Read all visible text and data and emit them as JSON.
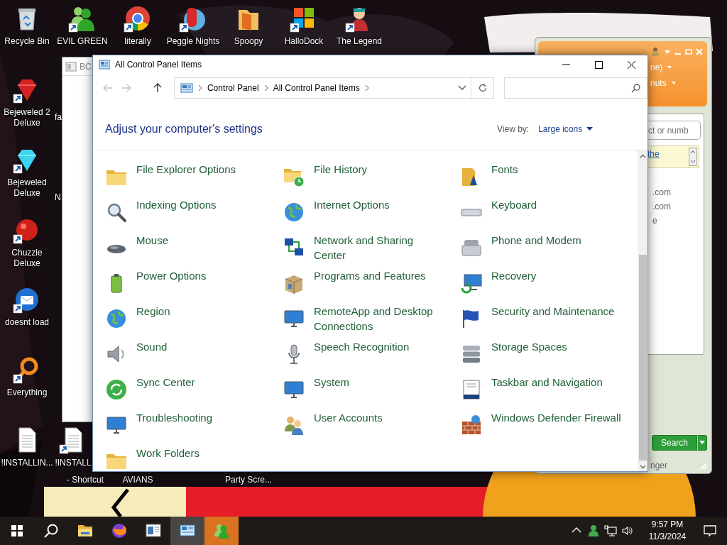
{
  "desktop_icons": [
    {
      "label": "Recycle Bin",
      "kind": "bin",
      "shortcut": false
    },
    {
      "label": "EVIL GREEN",
      "kind": "people",
      "shortcut": true
    },
    {
      "label": "literally",
      "kind": "ring-logo",
      "shortcut": true
    },
    {
      "label": "Peggle Nights",
      "kind": "game",
      "shortcut": true
    },
    {
      "label": "Spoopy",
      "kind": "folder",
      "shortcut": false
    },
    {
      "label": "HalloDock",
      "kind": "tiles",
      "shortcut": true
    },
    {
      "label": "The Legend",
      "kind": "figure",
      "shortcut": true
    },
    {
      "label": "Bejeweled 2 Deluxe",
      "kind": "gem-red",
      "shortcut": true
    },
    {
      "label": "Bejeweled Deluxe",
      "kind": "gem-blue",
      "shortcut": true
    },
    {
      "label": "Chuzzle Deluxe",
      "kind": "ball",
      "shortcut": true
    },
    {
      "label": "doesnt load",
      "kind": "envelope",
      "shortcut": true
    },
    {
      "label": "Everything",
      "kind": "magnifier",
      "shortcut": true
    },
    {
      "label": "!INSTALLIN...",
      "kind": "document",
      "shortcut": false
    },
    {
      "label": "!INSTALL",
      "kind": "document",
      "shortcut": true
    },
    {
      "label": "- Shortcut",
      "kind": "covered"
    },
    {
      "label": "AVIANS",
      "kind": "covered"
    },
    {
      "label": "Party Scre...",
      "kind": "covered"
    },
    {
      "label": "fa",
      "kind": "covered"
    },
    {
      "label": "N",
      "kind": "covered"
    }
  ],
  "left_window": {
    "title": "BC"
  },
  "messenger_window": {
    "header_lines": [
      "ne)",
      "nuts"
    ],
    "search": {
      "placeholder": "ct or numb"
    },
    "notice_link": "the",
    "list": [
      ".com",
      ".com",
      "e"
    ],
    "search_button": "Search",
    "status": "nger"
  },
  "control_panel": {
    "title": "All Control Panel Items",
    "nav": {
      "back_disabled": true,
      "forward_disabled": true
    },
    "breadcrumbs": [
      "Control Panel",
      "All Control Panel Items"
    ],
    "heading": "Adjust your computer's settings",
    "view_by_label": "View by:",
    "view_by_value": "Large icons",
    "items": [
      {
        "label": "File Explorer Options",
        "kind": "folder"
      },
      {
        "label": "File History",
        "kind": "history"
      },
      {
        "label": "Fonts",
        "kind": "fonts"
      },
      {
        "label": "Indexing Options",
        "kind": "magnifier"
      },
      {
        "label": "Internet Options",
        "kind": "globe"
      },
      {
        "label": "Keyboard",
        "kind": "keyboard"
      },
      {
        "label": "Mouse",
        "kind": "mouse"
      },
      {
        "label": "Network and Sharing Center",
        "kind": "network"
      },
      {
        "label": "Phone and Modem",
        "kind": "phone"
      },
      {
        "label": "Power Options",
        "kind": "battery"
      },
      {
        "label": "Programs and Features",
        "kind": "box"
      },
      {
        "label": "Recovery",
        "kind": "recovery"
      },
      {
        "label": "Region",
        "kind": "globe"
      },
      {
        "label": "RemoteApp and Desktop Connections",
        "kind": "monitor"
      },
      {
        "label": "Security and Maintenance",
        "kind": "flag"
      },
      {
        "label": "Sound",
        "kind": "speaker"
      },
      {
        "label": "Speech Recognition",
        "kind": "mic"
      },
      {
        "label": "Storage Spaces",
        "kind": "disks"
      },
      {
        "label": "Sync Center",
        "kind": "sync"
      },
      {
        "label": "System",
        "kind": "monitor"
      },
      {
        "label": "Taskbar and Navigation",
        "kind": "taskbar"
      },
      {
        "label": "Troubleshooting",
        "kind": "monitor"
      },
      {
        "label": "User Accounts",
        "kind": "users"
      },
      {
        "label": "Windows Defender Firewall",
        "kind": "wall"
      },
      {
        "label": "Work Folders",
        "kind": "folder"
      }
    ]
  },
  "taskbar": {
    "apps": [
      {
        "kind": "folder",
        "active": false,
        "attention": false
      },
      {
        "kind": "fox",
        "active": false,
        "attention": false
      },
      {
        "kind": "window",
        "active": false,
        "attention": false
      },
      {
        "kind": "panel",
        "active": true,
        "attention": false
      },
      {
        "kind": "people",
        "active": false,
        "attention": true
      }
    ],
    "time": "9:57 PM",
    "date": "11/3/2024"
  }
}
